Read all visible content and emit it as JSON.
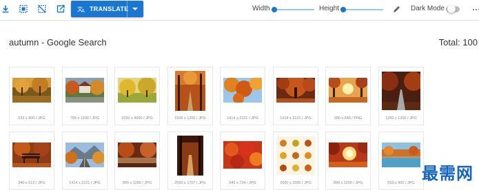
{
  "toolbar": {
    "translate_label": "TRANSLATE",
    "width_label": "Width",
    "width_value": 0.0,
    "height_label": "Height",
    "height_value": 0.0,
    "dark_mode_label": "Dark Mode",
    "dark_mode_on": false,
    "icons": [
      "download-icon",
      "select-all-icon",
      "deselect-icon",
      "export-icon",
      "translate-icon",
      "dropdown-caret-icon",
      "pencil-icon",
      "more-icon"
    ]
  },
  "colors": {
    "accent": "#1976d2",
    "accent_light": "#90caf9"
  },
  "header": {
    "title": "autumn - Google Search",
    "total": "Total: 100"
  },
  "rows": [
    [
      {
        "caption": "533 x 800 / JPG",
        "scene": "park"
      },
      {
        "caption": "799 x 1200 / JPG",
        "scene": "house"
      },
      {
        "caption": "2250 x 4000 / JPG",
        "scene": "meadow"
      },
      {
        "caption": "1500 x 1200 / JPG",
        "scene": "path"
      },
      {
        "caption": "1414 x 2121 / JPG",
        "scene": "leaves-sky"
      },
      {
        "caption": "1414 x 2121 / JPG",
        "scene": "tree"
      },
      {
        "caption": "380 x 640 / PNG",
        "scene": "sunset-trees"
      },
      {
        "caption": "1200 x 1200 / JPG",
        "scene": "road-dark"
      }
    ],
    [
      {
        "caption": "340 x 512 / JPG",
        "scene": "bench"
      },
      {
        "caption": "1414 x 2121 / JPG",
        "scene": "road-mountain"
      },
      {
        "caption": "900 x 1280 / JPG",
        "scene": "trees-river"
      },
      {
        "caption": "2560 x 1707 / JPG",
        "scene": "tunnel"
      },
      {
        "caption": "543 x 724 / JPG",
        "scene": "maple"
      },
      {
        "caption": "2000 x 2000 / JPG",
        "scene": "leaf-grid"
      },
      {
        "caption": "900 x 1200 / JPG",
        "scene": "sunburst"
      },
      {
        "caption": "553 x 900 / JPG",
        "scene": "lake"
      }
    ]
  ],
  "watermark": "最需网"
}
